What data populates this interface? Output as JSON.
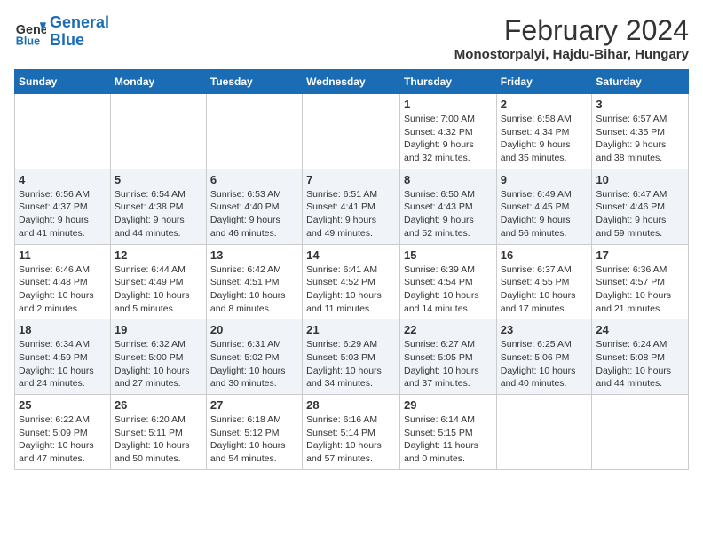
{
  "header": {
    "logo_line1": "General",
    "logo_line2": "Blue",
    "title": "February 2024",
    "subtitle": "Monostorpalyi, Hajdu-Bihar, Hungary"
  },
  "weekdays": [
    "Sunday",
    "Monday",
    "Tuesday",
    "Wednesday",
    "Thursday",
    "Friday",
    "Saturday"
  ],
  "weeks": [
    [
      {
        "day": "",
        "info": ""
      },
      {
        "day": "",
        "info": ""
      },
      {
        "day": "",
        "info": ""
      },
      {
        "day": "",
        "info": ""
      },
      {
        "day": "1",
        "info": "Sunrise: 7:00 AM\nSunset: 4:32 PM\nDaylight: 9 hours\nand 32 minutes."
      },
      {
        "day": "2",
        "info": "Sunrise: 6:58 AM\nSunset: 4:34 PM\nDaylight: 9 hours\nand 35 minutes."
      },
      {
        "day": "3",
        "info": "Sunrise: 6:57 AM\nSunset: 4:35 PM\nDaylight: 9 hours\nand 38 minutes."
      }
    ],
    [
      {
        "day": "4",
        "info": "Sunrise: 6:56 AM\nSunset: 4:37 PM\nDaylight: 9 hours\nand 41 minutes."
      },
      {
        "day": "5",
        "info": "Sunrise: 6:54 AM\nSunset: 4:38 PM\nDaylight: 9 hours\nand 44 minutes."
      },
      {
        "day": "6",
        "info": "Sunrise: 6:53 AM\nSunset: 4:40 PM\nDaylight: 9 hours\nand 46 minutes."
      },
      {
        "day": "7",
        "info": "Sunrise: 6:51 AM\nSunset: 4:41 PM\nDaylight: 9 hours\nand 49 minutes."
      },
      {
        "day": "8",
        "info": "Sunrise: 6:50 AM\nSunset: 4:43 PM\nDaylight: 9 hours\nand 52 minutes."
      },
      {
        "day": "9",
        "info": "Sunrise: 6:49 AM\nSunset: 4:45 PM\nDaylight: 9 hours\nand 56 minutes."
      },
      {
        "day": "10",
        "info": "Sunrise: 6:47 AM\nSunset: 4:46 PM\nDaylight: 9 hours\nand 59 minutes."
      }
    ],
    [
      {
        "day": "11",
        "info": "Sunrise: 6:46 AM\nSunset: 4:48 PM\nDaylight: 10 hours\nand 2 minutes."
      },
      {
        "day": "12",
        "info": "Sunrise: 6:44 AM\nSunset: 4:49 PM\nDaylight: 10 hours\nand 5 minutes."
      },
      {
        "day": "13",
        "info": "Sunrise: 6:42 AM\nSunset: 4:51 PM\nDaylight: 10 hours\nand 8 minutes."
      },
      {
        "day": "14",
        "info": "Sunrise: 6:41 AM\nSunset: 4:52 PM\nDaylight: 10 hours\nand 11 minutes."
      },
      {
        "day": "15",
        "info": "Sunrise: 6:39 AM\nSunset: 4:54 PM\nDaylight: 10 hours\nand 14 minutes."
      },
      {
        "day": "16",
        "info": "Sunrise: 6:37 AM\nSunset: 4:55 PM\nDaylight: 10 hours\nand 17 minutes."
      },
      {
        "day": "17",
        "info": "Sunrise: 6:36 AM\nSunset: 4:57 PM\nDaylight: 10 hours\nand 21 minutes."
      }
    ],
    [
      {
        "day": "18",
        "info": "Sunrise: 6:34 AM\nSunset: 4:59 PM\nDaylight: 10 hours\nand 24 minutes."
      },
      {
        "day": "19",
        "info": "Sunrise: 6:32 AM\nSunset: 5:00 PM\nDaylight: 10 hours\nand 27 minutes."
      },
      {
        "day": "20",
        "info": "Sunrise: 6:31 AM\nSunset: 5:02 PM\nDaylight: 10 hours\nand 30 minutes."
      },
      {
        "day": "21",
        "info": "Sunrise: 6:29 AM\nSunset: 5:03 PM\nDaylight: 10 hours\nand 34 minutes."
      },
      {
        "day": "22",
        "info": "Sunrise: 6:27 AM\nSunset: 5:05 PM\nDaylight: 10 hours\nand 37 minutes."
      },
      {
        "day": "23",
        "info": "Sunrise: 6:25 AM\nSunset: 5:06 PM\nDaylight: 10 hours\nand 40 minutes."
      },
      {
        "day": "24",
        "info": "Sunrise: 6:24 AM\nSunset: 5:08 PM\nDaylight: 10 hours\nand 44 minutes."
      }
    ],
    [
      {
        "day": "25",
        "info": "Sunrise: 6:22 AM\nSunset: 5:09 PM\nDaylight: 10 hours\nand 47 minutes."
      },
      {
        "day": "26",
        "info": "Sunrise: 6:20 AM\nSunset: 5:11 PM\nDaylight: 10 hours\nand 50 minutes."
      },
      {
        "day": "27",
        "info": "Sunrise: 6:18 AM\nSunset: 5:12 PM\nDaylight: 10 hours\nand 54 minutes."
      },
      {
        "day": "28",
        "info": "Sunrise: 6:16 AM\nSunset: 5:14 PM\nDaylight: 10 hours\nand 57 minutes."
      },
      {
        "day": "29",
        "info": "Sunrise: 6:14 AM\nSunset: 5:15 PM\nDaylight: 11 hours\nand 0 minutes."
      },
      {
        "day": "",
        "info": ""
      },
      {
        "day": "",
        "info": ""
      }
    ]
  ]
}
